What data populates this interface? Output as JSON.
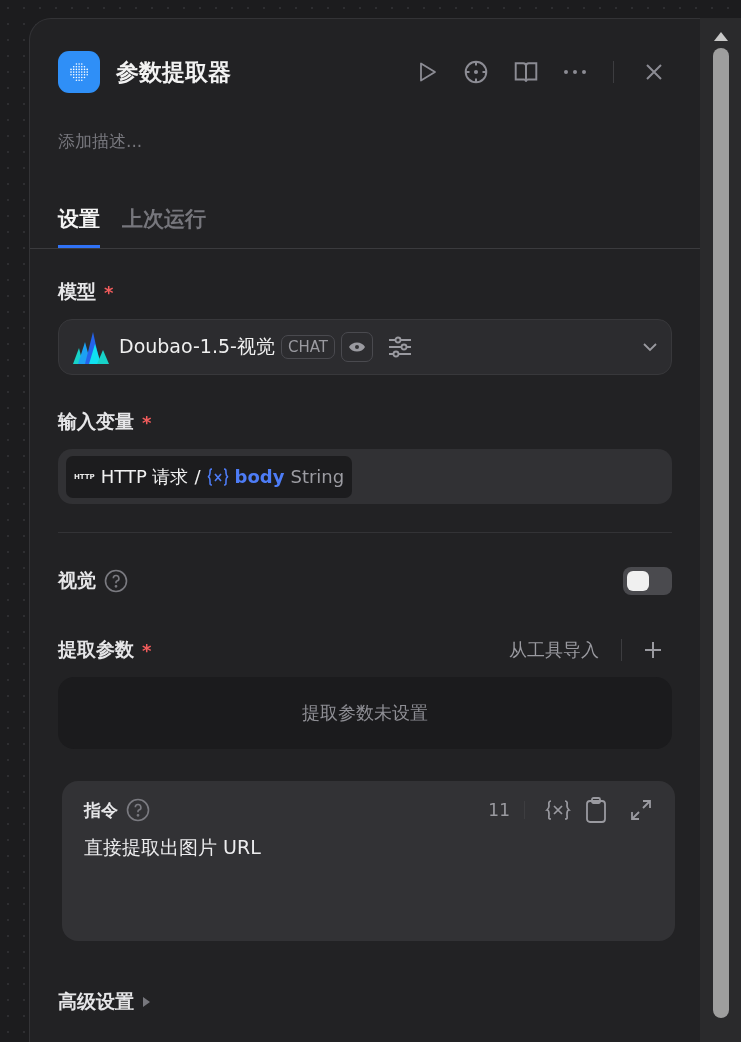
{
  "node": {
    "title": "参数提取器",
    "description_placeholder": "添加描述..."
  },
  "tabs": [
    {
      "label": "设置",
      "selected": true
    },
    {
      "label": "上次运行",
      "selected": false
    }
  ],
  "model": {
    "label": "模型",
    "mark": "*",
    "name": "Doubao-1.5-视觉",
    "tag": "CHAT"
  },
  "input_variables": {
    "label": "输入变量",
    "mark": "*",
    "source_badge": "HTTP",
    "node": "HTTP 请求",
    "separator": "/",
    "variable": "body",
    "type": "String"
  },
  "vision": {
    "label": "视觉",
    "on": false
  },
  "extract_params": {
    "label": "提取参数",
    "mark": "*",
    "import_label": "从工具导入",
    "empty_text": "提取参数未设置"
  },
  "instruction": {
    "label": "指令",
    "count": "11",
    "text": "直接提取出图片 URL"
  },
  "advanced": {
    "label": "高级设置",
    "expanded": false
  }
}
